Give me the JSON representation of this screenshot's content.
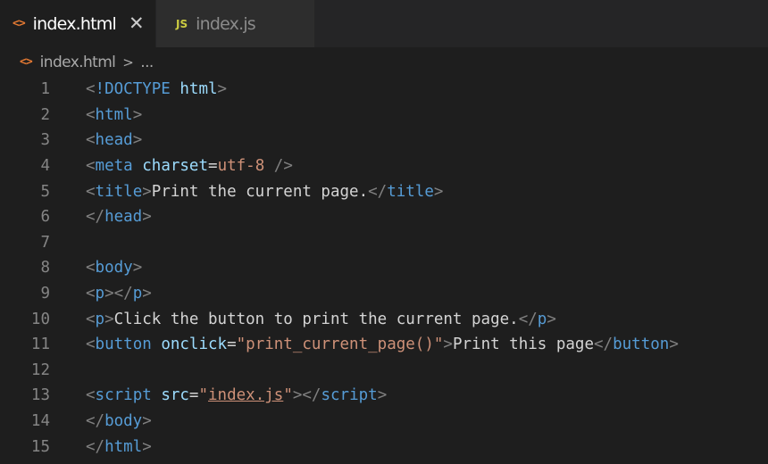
{
  "tabs": [
    {
      "label": "index.html",
      "icon": "<>",
      "active": true
    },
    {
      "label": "index.js",
      "icon": "JS",
      "active": false
    }
  ],
  "breadcrumb": {
    "icon": "<>",
    "file": "index.html",
    "separator": ">",
    "rest": "..."
  },
  "colors": {
    "punctuation": "#808080",
    "tag": "#569cd6",
    "attribute": "#9cdcfe",
    "string": "#ce9178",
    "text": "#d4d4d4",
    "line_number": "#858585"
  },
  "code_lines": [
    {
      "num": "1",
      "tokens": [
        [
          "punct",
          "<"
        ],
        [
          "tag",
          "!DOCTYPE"
        ],
        [
          "text",
          " "
        ],
        [
          "attr",
          "html"
        ],
        [
          "punct",
          ">"
        ]
      ]
    },
    {
      "num": "2",
      "tokens": [
        [
          "punct",
          "<"
        ],
        [
          "tag",
          "html"
        ],
        [
          "punct",
          ">"
        ]
      ]
    },
    {
      "num": "3",
      "tokens": [
        [
          "punct",
          "<"
        ],
        [
          "tag",
          "head"
        ],
        [
          "punct",
          ">"
        ]
      ]
    },
    {
      "num": "4",
      "tokens": [
        [
          "punct",
          "<"
        ],
        [
          "tag",
          "meta"
        ],
        [
          "text",
          " "
        ],
        [
          "attr",
          "charset"
        ],
        [
          "text",
          "="
        ],
        [
          "str",
          "utf-8"
        ],
        [
          "text",
          " "
        ],
        [
          "punct",
          "/>"
        ]
      ]
    },
    {
      "num": "5",
      "tokens": [
        [
          "punct",
          "<"
        ],
        [
          "tag",
          "title"
        ],
        [
          "punct",
          ">"
        ],
        [
          "text",
          "Print the current page."
        ],
        [
          "punct",
          "</"
        ],
        [
          "tag",
          "title"
        ],
        [
          "punct",
          ">"
        ]
      ]
    },
    {
      "num": "6",
      "tokens": [
        [
          "punct",
          "</"
        ],
        [
          "tag",
          "head"
        ],
        [
          "punct",
          ">"
        ]
      ]
    },
    {
      "num": "7",
      "tokens": []
    },
    {
      "num": "8",
      "tokens": [
        [
          "punct",
          "<"
        ],
        [
          "tag",
          "body"
        ],
        [
          "punct",
          ">"
        ]
      ]
    },
    {
      "num": "9",
      "tokens": [
        [
          "punct",
          "<"
        ],
        [
          "tag",
          "p"
        ],
        [
          "punct",
          "></"
        ],
        [
          "tag",
          "p"
        ],
        [
          "punct",
          ">"
        ]
      ]
    },
    {
      "num": "10",
      "tokens": [
        [
          "punct",
          "<"
        ],
        [
          "tag",
          "p"
        ],
        [
          "punct",
          ">"
        ],
        [
          "text",
          "Click the button to print the current page."
        ],
        [
          "punct",
          "</"
        ],
        [
          "tag",
          "p"
        ],
        [
          "punct",
          ">"
        ]
      ]
    },
    {
      "num": "11",
      "tokens": [
        [
          "punct",
          "<"
        ],
        [
          "tag",
          "button"
        ],
        [
          "text",
          " "
        ],
        [
          "attr",
          "onclick"
        ],
        [
          "text",
          "="
        ],
        [
          "str",
          "\"print_current_page()\""
        ],
        [
          "punct",
          ">"
        ],
        [
          "text",
          "Print this page"
        ],
        [
          "punct",
          "</"
        ],
        [
          "tag",
          "button"
        ],
        [
          "punct",
          ">"
        ]
      ]
    },
    {
      "num": "12",
      "tokens": []
    },
    {
      "num": "13",
      "tokens": [
        [
          "punct",
          "<"
        ],
        [
          "tag",
          "script"
        ],
        [
          "text",
          " "
        ],
        [
          "attr",
          "src"
        ],
        [
          "text",
          "="
        ],
        [
          "str",
          "\""
        ],
        [
          "link",
          "index.js"
        ],
        [
          "str",
          "\""
        ],
        [
          "punct",
          "></"
        ],
        [
          "tag",
          "script"
        ],
        [
          "punct",
          ">"
        ]
      ]
    },
    {
      "num": "14",
      "tokens": [
        [
          "punct",
          "</"
        ],
        [
          "tag",
          "body"
        ],
        [
          "punct",
          ">"
        ]
      ]
    },
    {
      "num": "15",
      "tokens": [
        [
          "punct",
          "</"
        ],
        [
          "tag",
          "html"
        ],
        [
          "punct",
          ">"
        ]
      ]
    }
  ]
}
